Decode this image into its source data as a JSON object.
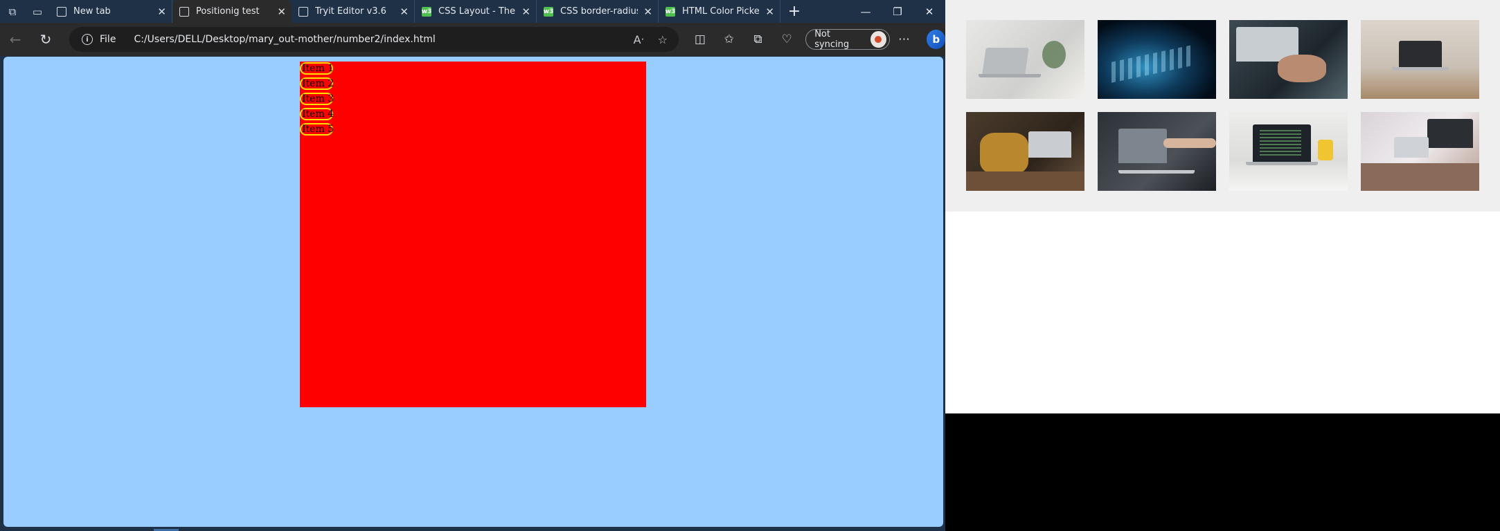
{
  "browser": {
    "tabs": [
      {
        "label": "New tab",
        "favicon": "page-icon",
        "active": false
      },
      {
        "label": "Positionig test",
        "favicon": "page-icon",
        "active": true
      },
      {
        "label": "Tryit Editor v3.6",
        "favicon": "page-icon",
        "active": false
      },
      {
        "label": "CSS Layout - The po",
        "favicon": "w3schools-icon",
        "active": false
      },
      {
        "label": "CSS border-radius p",
        "favicon": "w3schools-icon",
        "active": false
      },
      {
        "label": "HTML Color Picker",
        "favicon": "w3schools-icon",
        "active": false
      }
    ],
    "address": {
      "scheme_label": "File",
      "url": "C:/Users/DELL/Desktop/mary_out-mother/number2/index.html"
    },
    "sync_label": "Not syncing"
  },
  "page": {
    "background_color": "#99ccff",
    "box_color": "#ff0000",
    "item_border_color": "#ffe000",
    "items": [
      "Item 1",
      "Item 2",
      "Item 3",
      "Item 4",
      "Item 5"
    ]
  },
  "gallery": {
    "images": [
      "laptop-on-white-desk-photo",
      "glowing-keyboard-photo",
      "hands-typing-laptop-photo",
      "laptop-on-wooden-table-photo",
      "person-using-laptop-photo",
      "pointing-at-laptop-screen-photo",
      "code-on-laptop-photo",
      "desk-with-monitor-photo"
    ]
  }
}
